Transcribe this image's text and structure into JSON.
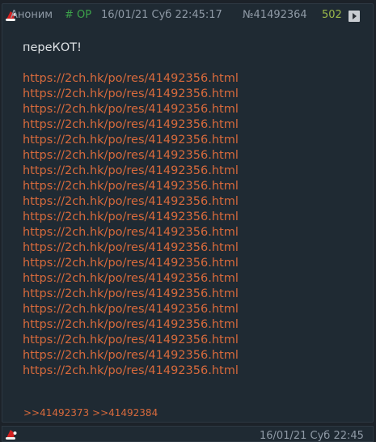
{
  "post": {
    "author": "Аноним",
    "op_tag": "# OP",
    "date": "16/01/21 Суб 22:45:17",
    "number": "№41492364",
    "reply_count": "502",
    "text": "переКОТ!",
    "links": [
      "https://2ch.hk/po/res/41492356.html",
      "https://2ch.hk/po/res/41492356.html",
      "https://2ch.hk/po/res/41492356.html",
      "https://2ch.hk/po/res/41492356.html",
      "https://2ch.hk/po/res/41492356.html",
      "https://2ch.hk/po/res/41492356.html",
      "https://2ch.hk/po/res/41492356.html",
      "https://2ch.hk/po/res/41492356.html",
      "https://2ch.hk/po/res/41492356.html",
      "https://2ch.hk/po/res/41492356.html",
      "https://2ch.hk/po/res/41492356.html",
      "https://2ch.hk/po/res/41492356.html",
      "https://2ch.hk/po/res/41492356.html",
      "https://2ch.hk/po/res/41492356.html",
      "https://2ch.hk/po/res/41492356.html",
      "https://2ch.hk/po/res/41492356.html",
      "https://2ch.hk/po/res/41492356.html",
      "https://2ch.hk/po/res/41492356.html",
      "https://2ch.hk/po/res/41492356.html",
      "https://2ch.hk/po/res/41492356.html"
    ],
    "replies": [
      ">>41492373",
      ">>41492384"
    ]
  },
  "next_post": {
    "date_fragment": "16/01/21 Суб 22:45"
  },
  "icons": {
    "hat": "santa-hat-icon",
    "expand": "play-triangle-icon"
  },
  "colors": {
    "background": "#1c2229",
    "post_background": "#1f2a33",
    "link": "#d86a3c",
    "op": "#3da34b",
    "reply_count": "#9ab84a",
    "meta": "#8f9aa6",
    "text": "#dfe3e6"
  }
}
